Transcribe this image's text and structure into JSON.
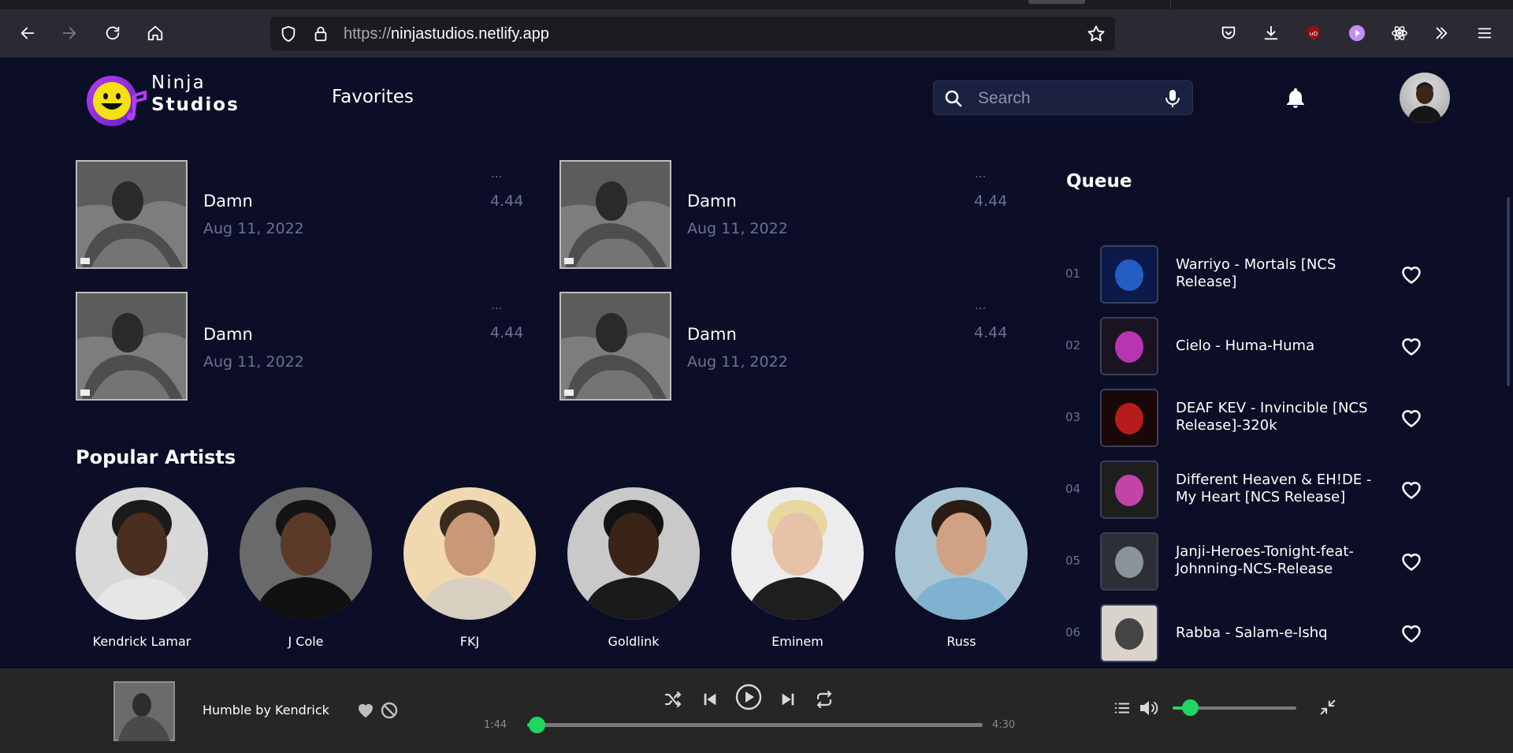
{
  "browser": {
    "url_protocol": "https://",
    "url_host": "ninjastudios.netlify.app"
  },
  "header": {
    "brand_line1": "Ninja",
    "brand_line2": "Studios",
    "nav_favorites": "Favorites",
    "search_placeholder": "Search"
  },
  "favorites": [
    {
      "title": "Damn",
      "date": "Aug 11, 2022",
      "menu": "...",
      "duration": "4.44"
    },
    {
      "title": "Damn",
      "date": "Aug 11, 2022",
      "menu": "...",
      "duration": "4.44"
    },
    {
      "title": "Damn",
      "date": "Aug 11, 2022",
      "menu": "...",
      "duration": "4.44"
    },
    {
      "title": "Damn",
      "date": "Aug 11, 2022",
      "menu": "...",
      "duration": "4.44"
    }
  ],
  "popular_artists": {
    "title": "Popular Artists",
    "items": [
      {
        "name": "Kendrick Lamar"
      },
      {
        "name": "J Cole"
      },
      {
        "name": "FKJ"
      },
      {
        "name": "Goldlink"
      },
      {
        "name": "Eminem"
      },
      {
        "name": "Russ"
      }
    ]
  },
  "queue": {
    "title": "Queue",
    "items": [
      {
        "index": "01",
        "title": "Warriyo - Mortals [NCS Release]"
      },
      {
        "index": "02",
        "title": "Cielo - Huma-Huma"
      },
      {
        "index": "03",
        "title": "DEAF KEV - Invincible [NCS Release]-320k"
      },
      {
        "index": "04",
        "title": "Different Heaven & EH!DE - My Heart [NCS Release]"
      },
      {
        "index": "05",
        "title": "Janji-Heroes-Tonight-feat-Johnning-NCS-Release"
      },
      {
        "index": "06",
        "title": "Rabba - Salam-e-Ishq"
      }
    ]
  },
  "player": {
    "now_playing": "Humble by Kendrick",
    "elapsed": "1:44",
    "total": "4:30",
    "progress_fraction": 0.02,
    "volume_fraction": 0.14
  },
  "colors": {
    "background": "#0b0e26",
    "accent": "#1ed760",
    "player_bg": "#262626",
    "muted_text": "#6a7193"
  }
}
